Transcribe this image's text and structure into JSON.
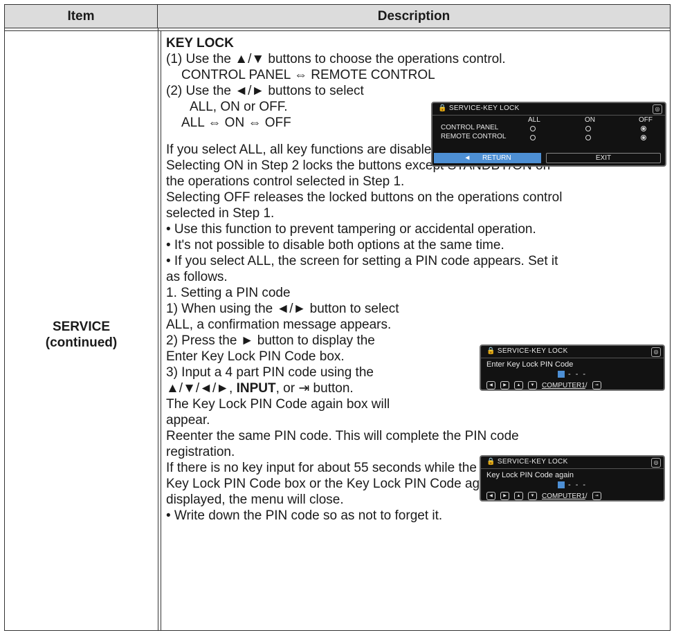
{
  "header": {
    "item": "Item",
    "description": "Description"
  },
  "item_label": [
    "SERVICE",
    "(continued)"
  ],
  "text": {
    "l01": "KEY LOCK",
    "l02": "(1) Use the ▲/▼ buttons to choose the operations control.",
    "l03": "CONTROL PANEL ⇔ REMOTE CONTROL",
    "l04": "(2) Use the ◄/► buttons to select",
    "l05": "ALL, ON or OFF.",
    "l06": "ALL ⇔ ON ⇔ OFF",
    "l07": "If you select ALL, all key functions are disabled.",
    "l08": "Selecting ON in Step 2 locks the buttons except STANDBY/ON on",
    "l09": "the operations control selected in Step 1.",
    "l10": "Selecting OFF releases the locked buttons on the operations control",
    "l11": "selected in Step 1.",
    "l12": "• Use this function to prevent tampering or accidental operation.",
    "l13": "• It's not possible to disable both options at the same time.",
    "l14": "• If you select ALL, the screen for setting a PIN code appears. Set it",
    "l15": "as follows.",
    "l16": "1. Setting a PIN code",
    "l17": "1) When using the ◄/► button to select",
    "l18": "ALL, a confirmation message appears.",
    "l19": "2) Press the ► button to display the",
    "l20": "Enter Key Lock PIN Code box.",
    "l21": "3) Input a 4 part PIN code using the",
    "l22a": "▲/▼/◄/►, ",
    "l22b": "INPUT",
    "l22c": ", or ⇥ button.",
    "l23": "The Key Lock PIN Code again box will",
    "l24": "appear.",
    "l25": "Reenter the same PIN code. This will complete the PIN code",
    "l26": "registration.",
    "l27": "If there is no key input for about 55 seconds while the Enter",
    "l28": "Key Lock PIN Code box or the Key Lock PIN Code again box is",
    "l29": "displayed, the menu will close.",
    "l30": "• Write down the PIN code so as not to forget it."
  },
  "osd1": {
    "title": "SERVICE-KEY LOCK",
    "cols": [
      "ALL",
      "ON",
      "OFF"
    ],
    "rows": [
      "CONTROL PANEL",
      "REMOTE CONTROL"
    ],
    "selected": [
      "OFF",
      "OFF"
    ],
    "return_label": "RETURN",
    "exit_label": "EXIT"
  },
  "osd2": {
    "title": "SERVICE-KEY LOCK",
    "prompt": "Enter Key Lock PIN Code",
    "pin_rest": "- - -",
    "source": "COMPUTER1",
    "sep": "/"
  },
  "osd3": {
    "title": "SERVICE-KEY LOCK",
    "prompt": "Key Lock PIN Code again",
    "pin_rest": "- - -",
    "source": "COMPUTER1",
    "sep": "/"
  }
}
